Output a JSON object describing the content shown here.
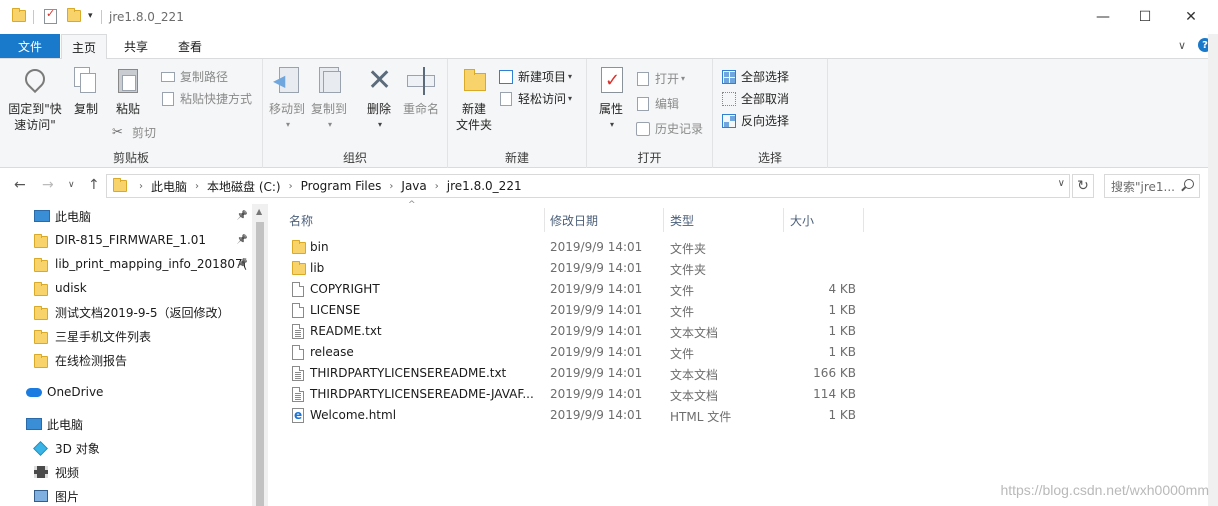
{
  "title": {
    "text": "jre1.8.0_221",
    "minimize": "—",
    "maximize": "☐",
    "close": "✕"
  },
  "tabs": {
    "file": "文件",
    "home": "主页",
    "share": "共享",
    "view": "查看",
    "collapse": "∨",
    "help": "?"
  },
  "ribbon": {
    "clipboard": {
      "label": "剪贴板",
      "pin_line1": "固定到\"快",
      "pin_line2": "速访问\"",
      "copy": "复制",
      "paste": "粘贴",
      "copy_path": "复制路径",
      "paste_shortcut": "粘贴快捷方式",
      "cut": "剪切"
    },
    "organize": {
      "label": "组织",
      "move_to": "移动到",
      "copy_to": "复制到",
      "delete": "删除",
      "rename": "重命名"
    },
    "new": {
      "label": "新建",
      "new_folder_line1": "新建",
      "new_folder_line2": "文件夹",
      "new_item": "新建项目",
      "easy_access": "轻松访问"
    },
    "open": {
      "label": "打开",
      "properties": "属性",
      "open": "打开",
      "edit": "编辑",
      "history": "历史记录"
    },
    "select": {
      "label": "选择",
      "select_all": "全部选择",
      "select_none": "全部取消",
      "invert": "反向选择"
    }
  },
  "address": {
    "crumbs": [
      "此电脑",
      "本地磁盘 (C:)",
      "Program Files",
      "Java",
      "jre1.8.0_221"
    ],
    "search_placeholder": "搜索\"jre1..."
  },
  "nav": {
    "items": [
      {
        "label": "此电脑",
        "icon": "computer-icon",
        "pinned": true
      },
      {
        "label": "DIR-815_FIRMWARE_1.01",
        "icon": "folder-icon",
        "pinned": true
      },
      {
        "label": "lib_print_mapping_info_201807(",
        "icon": "folder-icon",
        "pinned": true
      },
      {
        "label": "udisk",
        "icon": "folder-icon",
        "pinned": false
      },
      {
        "label": "测试文档2019-9-5（返回修改）",
        "icon": "folder-icon",
        "pinned": false
      },
      {
        "label": "三星手机文件列表",
        "icon": "folder-icon",
        "pinned": false
      },
      {
        "label": "在线检测报告",
        "icon": "folder-icon",
        "pinned": false
      },
      {
        "label": "OneDrive",
        "icon": "cloud-icon",
        "pinned": false
      },
      {
        "label": "此电脑",
        "icon": "computer-icon",
        "pinned": false
      },
      {
        "label": "3D 对象",
        "icon": "cube-icon",
        "pinned": false
      },
      {
        "label": "视频",
        "icon": "video-icon",
        "pinned": false
      },
      {
        "label": "图片",
        "icon": "picture-icon",
        "pinned": false
      }
    ]
  },
  "list": {
    "columns": {
      "name": "名称",
      "date": "修改日期",
      "type": "类型",
      "size": "大小"
    },
    "rows": [
      {
        "name": "bin",
        "date": "2019/9/9 14:01",
        "type": "文件夹",
        "size": "",
        "icon": "folder-icon"
      },
      {
        "name": "lib",
        "date": "2019/9/9 14:01",
        "type": "文件夹",
        "size": "",
        "icon": "folder-icon"
      },
      {
        "name": "COPYRIGHT",
        "date": "2019/9/9 14:01",
        "type": "文件",
        "size": "4 KB",
        "icon": "file-icon"
      },
      {
        "name": "LICENSE",
        "date": "2019/9/9 14:01",
        "type": "文件",
        "size": "1 KB",
        "icon": "file-icon"
      },
      {
        "name": "README.txt",
        "date": "2019/9/9 14:01",
        "type": "文本文档",
        "size": "1 KB",
        "icon": "text-file-icon"
      },
      {
        "name": "release",
        "date": "2019/9/9 14:01",
        "type": "文件",
        "size": "1 KB",
        "icon": "file-icon"
      },
      {
        "name": "THIRDPARTYLICENSEREADME.txt",
        "date": "2019/9/9 14:01",
        "type": "文本文档",
        "size": "166 KB",
        "icon": "text-file-icon"
      },
      {
        "name": "THIRDPARTYLICENSEREADME-JAVAF...",
        "date": "2019/9/9 14:01",
        "type": "文本文档",
        "size": "114 KB",
        "icon": "text-file-icon"
      },
      {
        "name": "Welcome.html",
        "date": "2019/9/9 14:01",
        "type": "HTML 文件",
        "size": "1 KB",
        "icon": "html-file-icon"
      }
    ]
  },
  "watermark": "https://blog.csdn.net/wxh0000mm",
  "colors": {
    "accent": "#1979ca",
    "ribbon_bg": "#f5f6f7",
    "folder": "#f8d36b"
  }
}
